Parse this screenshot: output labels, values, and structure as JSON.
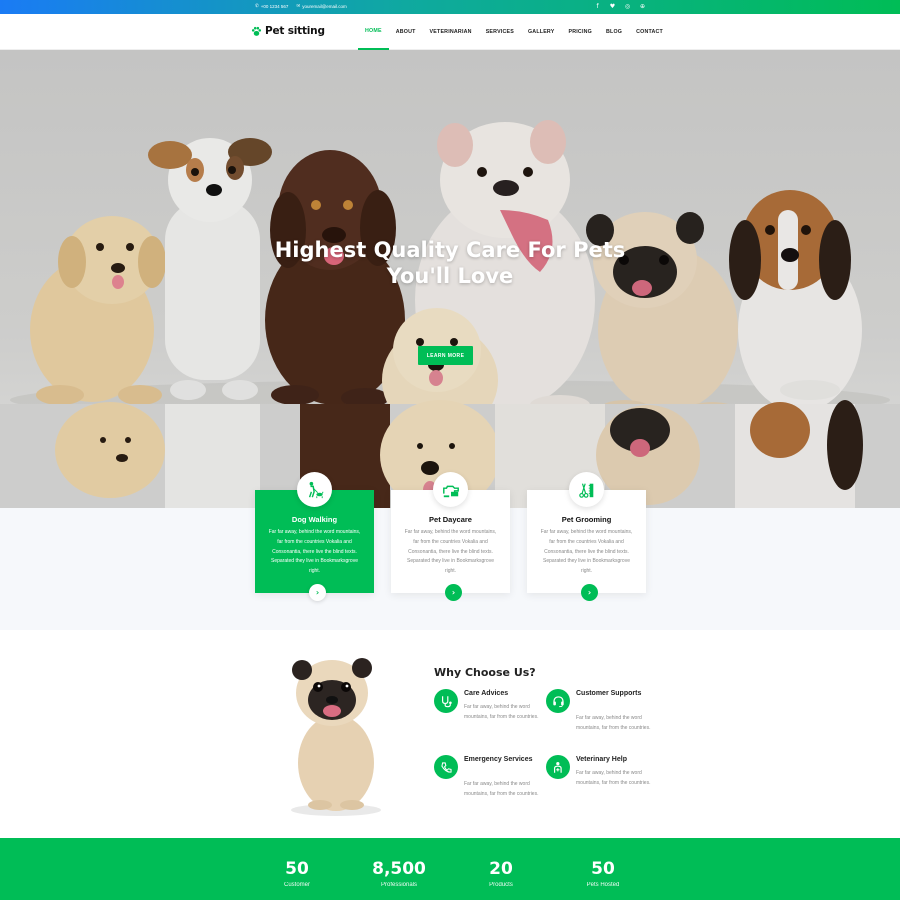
{
  "topbar": {
    "phone": "+00 1234 567",
    "email": "youremail@email.com",
    "social_icons": [
      "facebook-icon",
      "twitter-icon",
      "instagram-icon",
      "dribbble-icon"
    ]
  },
  "brand": {
    "name": "Pet sitting",
    "icon": "paw-icon"
  },
  "menu": [
    {
      "label": "HOME",
      "active": true
    },
    {
      "label": "ABOUT"
    },
    {
      "label": "VETERINARIAN"
    },
    {
      "label": "SERVICES"
    },
    {
      "label": "GALLERY"
    },
    {
      "label": "PRICING"
    },
    {
      "label": "BLOG"
    },
    {
      "label": "CONTACT"
    }
  ],
  "hero": {
    "title_line1": "Highest Quality Care For Pets",
    "title_line2": "You'll Love",
    "button": "LEARN MORE"
  },
  "services": [
    {
      "title": "Dog Walking",
      "desc": "Far far away, behind the word mountains, far from the countries Vokalia and Consonantia, there live the blind texts. Separated they live in Bookmarksgrove right.",
      "icon": "dog-walking-icon"
    },
    {
      "title": "Pet Daycare",
      "desc": "Far far away, behind the word mountains, far from the countries Vokalia and Consonantia, there live the blind texts. Separated they live in Bookmarksgrove right.",
      "icon": "pet-daycare-icon"
    },
    {
      "title": "Pet Grooming",
      "desc": "Far far away, behind the word mountains, far from the countries Vokalia and Consonantia, there live the blind texts. Separated they live in Bookmarksgrove right.",
      "icon": "grooming-icon"
    }
  ],
  "why": {
    "title": "Why Choose Us?",
    "features": [
      {
        "title": "Care Advices",
        "desc": "Far far away, behind the word mountains, far from the countries.",
        "icon": "stethoscope-icon"
      },
      {
        "title": "Customer Supports",
        "desc": "Far far away, behind the word mountains, far from the countries.",
        "icon": "customer-support-icon"
      },
      {
        "title": "Emergency Services",
        "desc": "Far far away, behind the word mountains, far from the countries.",
        "icon": "emergency-icon"
      },
      {
        "title": "Veterinary Help",
        "desc": "Far far away, behind the word mountains, far from the countries.",
        "icon": "veterinary-icon"
      }
    ]
  },
  "stats": [
    {
      "num": "50",
      "label": "Customer"
    },
    {
      "num": "8,500",
      "label": "Professionals"
    },
    {
      "num": "20",
      "label": "Products"
    },
    {
      "num": "50",
      "label": "Pets Hosted"
    }
  ],
  "colors": {
    "accent": "#00bd56",
    "gradient_start": "#1a7bf5"
  }
}
